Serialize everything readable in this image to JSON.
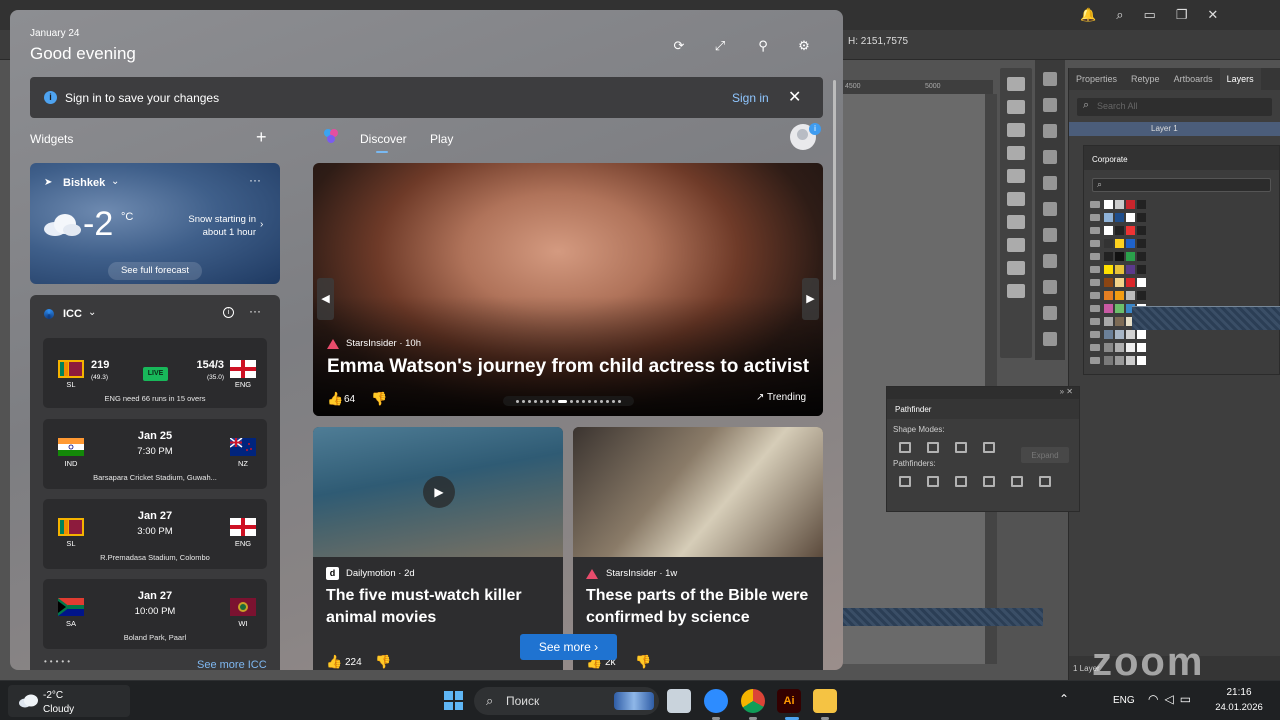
{
  "board": {
    "date": "January 24",
    "greeting": "Good evening"
  },
  "signin": {
    "message": "Sign in to save your changes",
    "link": "Sign in"
  },
  "widgets": {
    "label": "Widgets"
  },
  "weather": {
    "location": "Bishkek",
    "temp": "-2",
    "unit": "°C",
    "message": "Snow starting in about 1 hour",
    "forecast_button": "See full forecast"
  },
  "icc": {
    "title": "ICC",
    "matches": [
      {
        "team_left": "SL",
        "team_right": "ENG",
        "score_left": "219",
        "overs_left": "(49.3)",
        "score_right": "154/3",
        "overs_right": "(35.0)",
        "status": "LIVE",
        "note": "ENG need 66 runs in 15 overs"
      },
      {
        "team_left": "IND",
        "team_right": "NZ",
        "date": "Jan 25",
        "time": "7:30 PM",
        "venue": "Barsapara Cricket Stadium, Guwah..."
      },
      {
        "team_left": "SL",
        "team_right": "ENG",
        "date": "Jan 27",
        "time": "3:00 PM",
        "venue": "R.Premadasa Stadium, Colombo"
      },
      {
        "team_left": "SA",
        "team_right": "WI",
        "date": "Jan 27",
        "time": "10:00 PM",
        "venue": "Boland Park, Paarl"
      }
    ],
    "see_more": "See more ICC"
  },
  "feed": {
    "tabs": [
      "Discover",
      "Play"
    ],
    "hero": {
      "source": "StarsInsider · 10h",
      "title": "Emma Watson's journey from child actress to activist",
      "likes": "64",
      "trend": "Trending"
    },
    "cards": [
      {
        "source": "Dailymotion · 2d",
        "title": "The five must-watch killer animal movies",
        "likes": "224"
      },
      {
        "source": "StarsInsider · 1w",
        "title": "These parts of the Bible were confirmed by science",
        "likes": "2k"
      }
    ],
    "see_more": "See more"
  },
  "illustrator": {
    "coord": "2151,7575",
    "ruler": [
      "4500",
      "5000"
    ],
    "panel_tabs": [
      "Properties",
      "Retype",
      "Artboards",
      "Layers"
    ],
    "search_placeholder": "Search All",
    "layer_name": "Layer 1",
    "corporate_tab": "Corporate",
    "pathfinder_tab": "Pathfinder",
    "shape_modes": "Shape Modes:",
    "pathfinders": "Pathfinders:",
    "expand": "Expand",
    "layers_count": "1 Layer",
    "zoom_logo": "zoom"
  },
  "taskbar": {
    "temp": "-2°C",
    "condition": "Cloudy",
    "search": "Поиск",
    "ai_label": "Ai",
    "lang": "ENG",
    "time": "21:16",
    "date": "24.01.2026"
  },
  "colors": {
    "accent": "#1f73d1",
    "live": "#18b85a",
    "link": "#8fc6ff"
  }
}
